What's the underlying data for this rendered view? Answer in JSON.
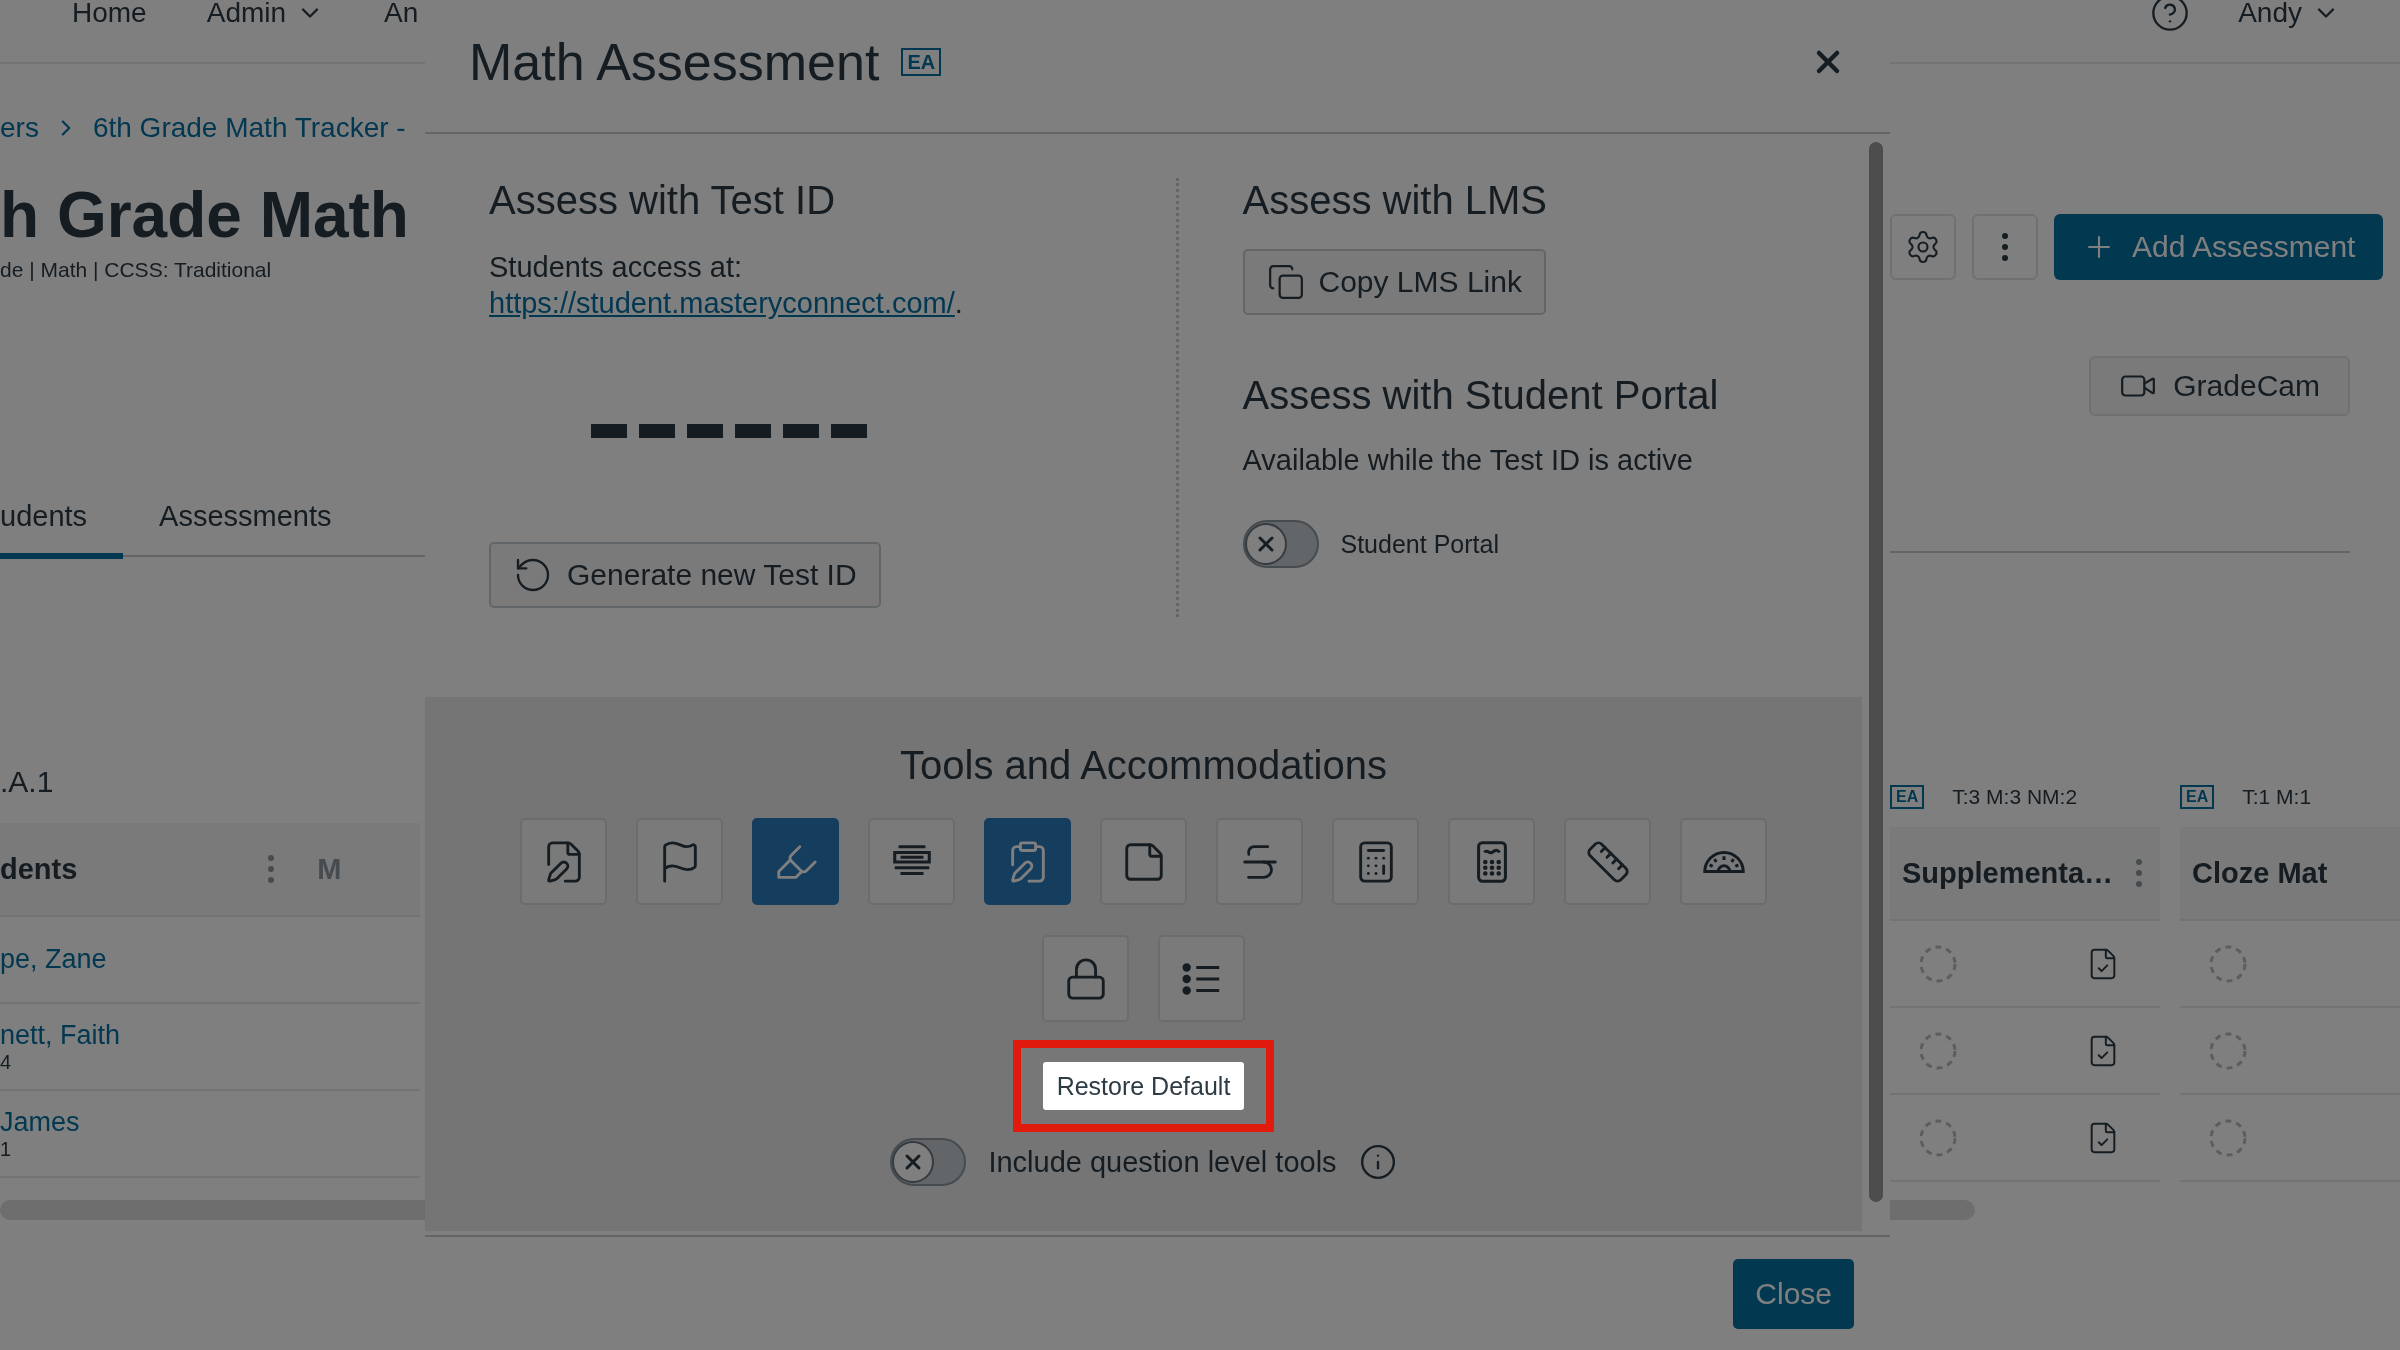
{
  "nav": {
    "items": [
      {
        "label": "Home",
        "caret": false
      },
      {
        "label": "Admin",
        "caret": true
      },
      {
        "label": "An",
        "caret": false
      }
    ],
    "user": "Andy"
  },
  "breadcrumb": [
    "ers",
    "6th Grade Math Tracker -"
  ],
  "page_title": "h Grade Math",
  "subtitle": "de | Math | CCSS: Traditional",
  "tabs": [
    {
      "label": "udents",
      "selected": true
    },
    {
      "label": "Assessments",
      "selected": false
    }
  ],
  "standard": ".A.1",
  "left_table": {
    "header": "dents",
    "next_header": "M",
    "rows": [
      {
        "name": "pe, Zane"
      },
      {
        "name": "nett, Faith",
        "sub": "4"
      },
      {
        "name": "James",
        "sub": "1"
      }
    ]
  },
  "actions": {
    "add_button": "Add Assessment",
    "gradecam_button": "GradeCam"
  },
  "right_columns": [
    {
      "badge": "EA",
      "counts": "T:3 M:3 NM:2",
      "title": "Supplementa…"
    },
    {
      "badge": "EA",
      "counts": "T:1 M:1",
      "title": "Cloze Mat"
    }
  ],
  "modal": {
    "title": "Math Assessment",
    "badge": "EA",
    "test_id": {
      "heading": "Assess with Test ID",
      "access_label": "Students access at:",
      "link": "https://student.masteryconnect.com/",
      "link_suffix": ".",
      "generate_button": "Generate new Test ID"
    },
    "lms": {
      "heading": "Assess with LMS",
      "copy_button": "Copy LMS Link"
    },
    "portal": {
      "heading": "Assess with Student Portal",
      "note": "Available while the Test ID is active",
      "toggle": {
        "label": "Student Portal",
        "on": false
      }
    },
    "tools": {
      "heading": "Tools and Accommodations",
      "items": [
        {
          "selected": false
        },
        {
          "selected": false
        },
        {
          "selected": true
        },
        {
          "selected": false
        },
        {
          "selected": true
        },
        {
          "selected": false
        },
        {
          "selected": false
        },
        {
          "selected": false
        },
        {
          "selected": false
        },
        {
          "selected": false
        },
        {
          "selected": false
        },
        {
          "selected": false
        },
        {
          "selected": false
        }
      ],
      "restore_button": "Restore Default",
      "restore_highlighted": true,
      "question_tools": {
        "label": "Include question level tools",
        "on": false
      }
    },
    "close_button": "Close"
  }
}
